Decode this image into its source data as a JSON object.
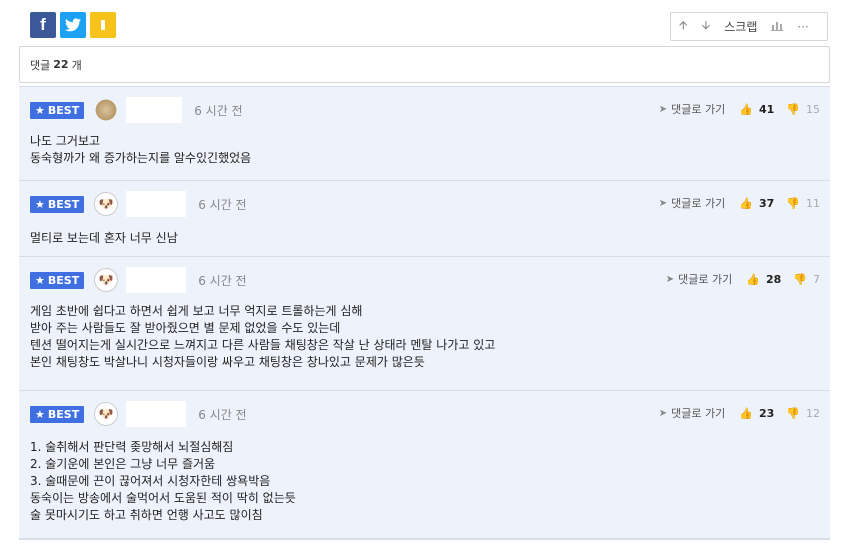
{
  "share": {
    "facebook": "f",
    "twitter": "🐦",
    "kakao": ","
  },
  "toolbar": {
    "scrap": "스크랩",
    "more": "···"
  },
  "comment_count": {
    "label": "댓글",
    "value": "22",
    "unit": "개"
  },
  "comments": [
    {
      "badge": "BEST",
      "time": "6 시간 전",
      "reply": "댓글로 가기",
      "likes": "41",
      "dislikes": "15",
      "lines": [
        "나도 그거보고",
        "동숙형까가 왜 증가하는지를 알수있긴했었음"
      ]
    },
    {
      "badge": "BEST",
      "time": "6 시간 전",
      "reply": "댓글로 가기",
      "likes": "37",
      "dislikes": "11",
      "lines": [
        "멀티로 보는데 혼자 너무 신남"
      ]
    },
    {
      "badge": "BEST",
      "time": "6 시간 전",
      "reply": "댓글로 가기",
      "likes": "28",
      "dislikes": "7",
      "lines": [
        "게임 초반에 쉽다고 하면서 쉽게 보고 너무 억지로 트롤하는게 심해",
        "받아 주는 사람들도 잘 받아줬으면 별 문제 없었을 수도 있는데",
        "텐션 떨어지는게 실시간으로 느껴지고 다른 사람들 채팅창은 작살 난 상태라 멘탈 나가고 있고",
        "본인 채팅창도 박살나니 시청자들이랑 싸우고 채팅창은 창나있고 문제가 많은듯"
      ]
    },
    {
      "badge": "BEST",
      "time": "6 시간 전",
      "reply": "댓글로 가기",
      "likes": "23",
      "dislikes": "12",
      "lines": [
        "1. 술취해서 판단력 좆망해서 뇌절심해짐",
        "2. 술기운에 본인은 그냥 너무 즐거움",
        "3. 술때문에 끈이 끊어져서 시청자한테 쌍욕박음",
        "동숙이는 방송에서 술먹어서 도움된 적이 딱히 없는듯",
        "술 못마시기도 하고 취하면 언행 사고도 많이침"
      ]
    }
  ]
}
